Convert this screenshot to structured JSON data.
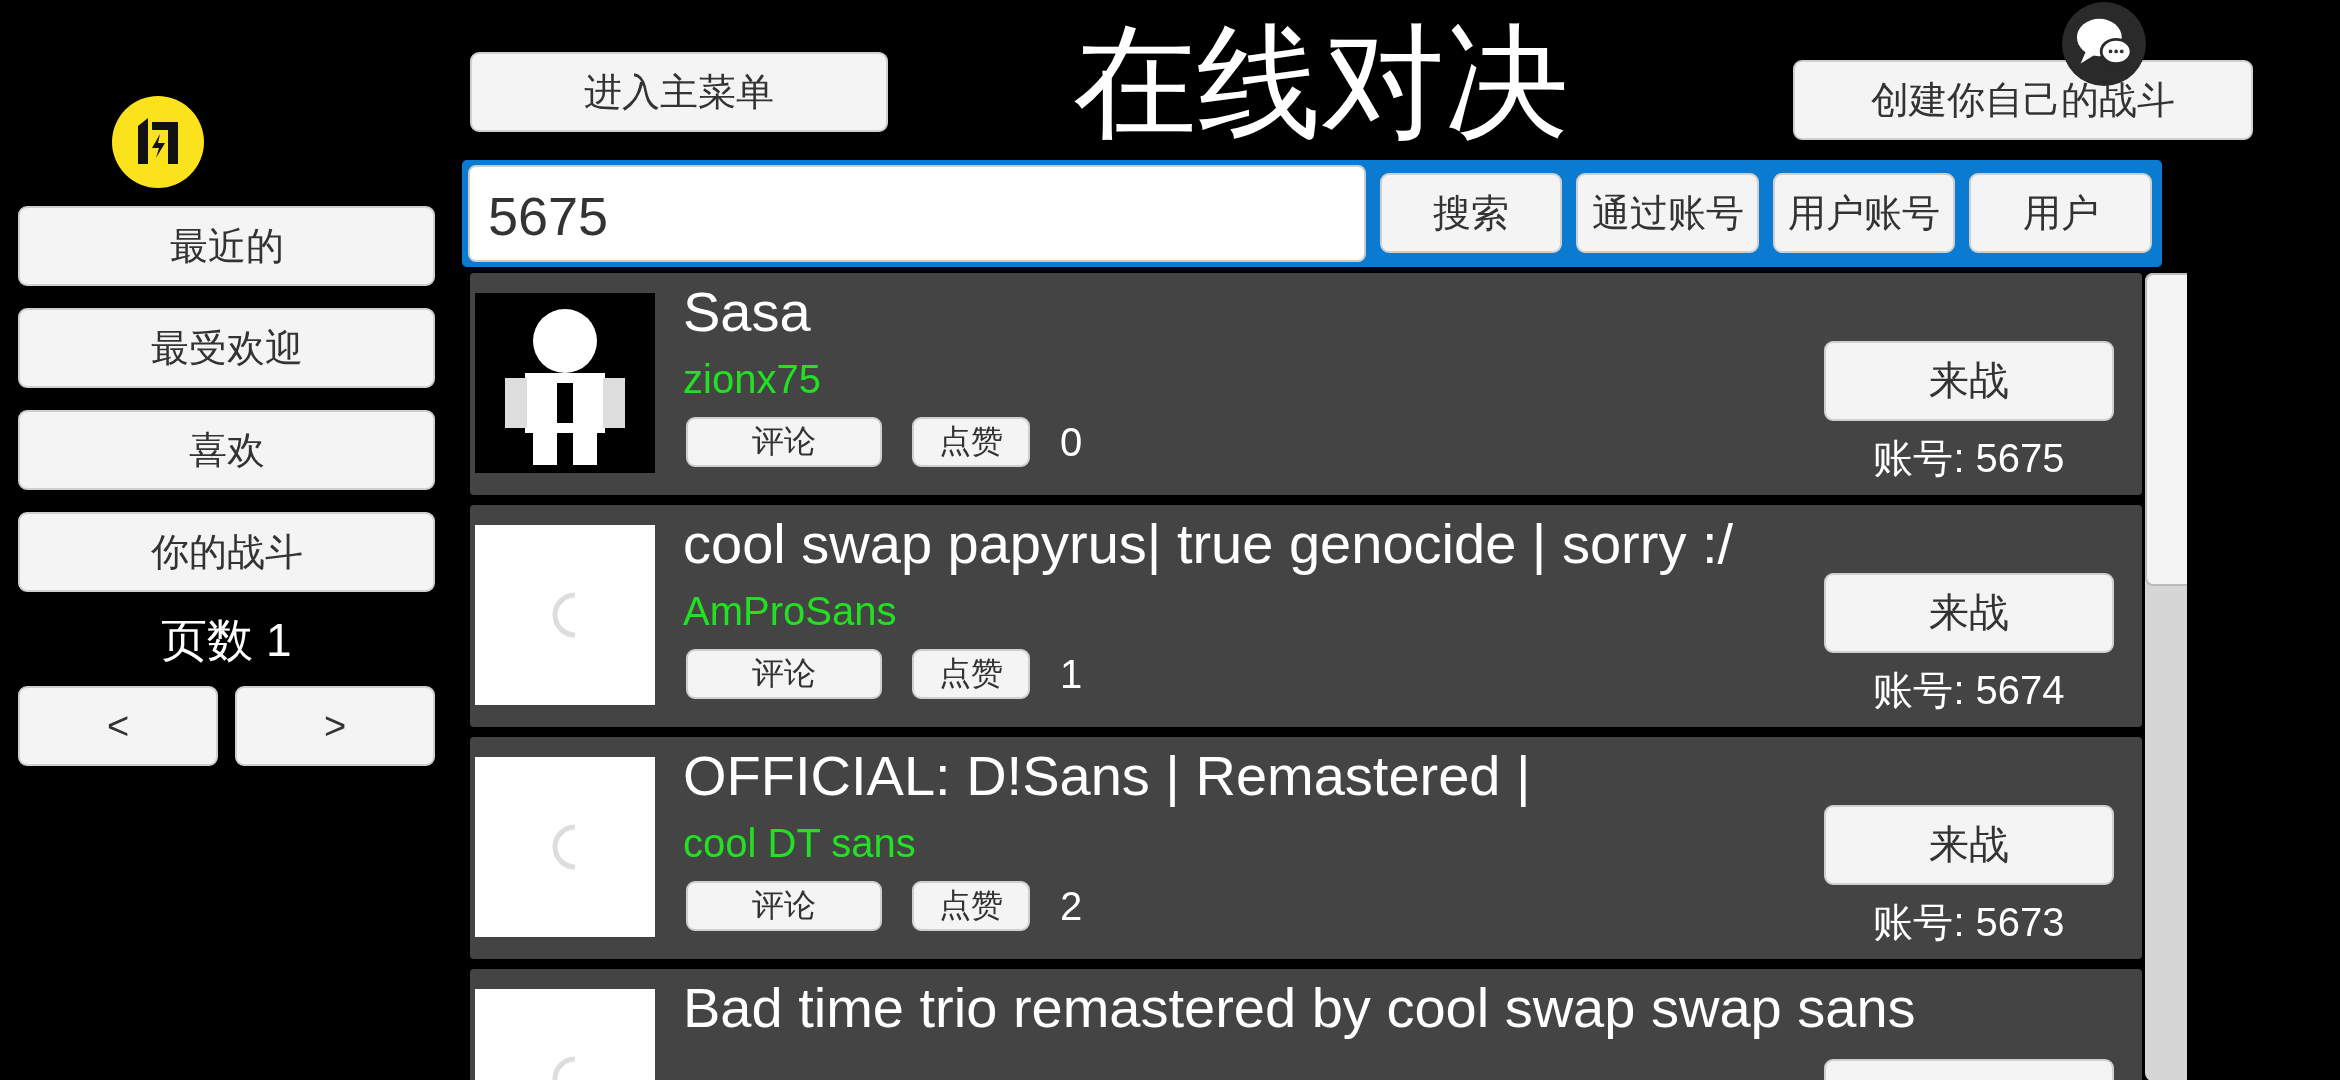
{
  "title": "在线对决",
  "main_menu_button": "进入主菜单",
  "create_button": "创建你自己的战斗",
  "sidebar": {
    "items": [
      {
        "label": "最近的"
      },
      {
        "label": "最受欢迎"
      },
      {
        "label": "喜欢"
      },
      {
        "label": "你的战斗"
      }
    ],
    "page_label": "页数 1",
    "prev": "<",
    "next": ">"
  },
  "search": {
    "value": "5675",
    "buttons": [
      "搜索",
      "通过账号",
      "用户账号",
      "用户"
    ]
  },
  "battles": [
    {
      "title": "Sasa",
      "author": "zionx75",
      "comment": "评论",
      "like": "点赞",
      "likes": "0",
      "fight": "来战",
      "id": "账号: 5675"
    },
    {
      "thumbnail": {
        "kind": "loading"
      },
      "title": "cool swap papyrus| true genocide | sorry :/",
      "author": "AmProSans",
      "comment": "评论",
      "like": "点赞",
      "likes": "1",
      "fight": "来战",
      "id": "账号: 5674"
    },
    {
      "thumbnail": {
        "kind": "loading"
      },
      "title": "OFFICIAL: D!Sans | Remastered |",
      "author": "cool DT sans",
      "comment": "评论",
      "like": "点赞",
      "likes": "2",
      "fight": "来战",
      "id": "账号: 5673"
    },
    {
      "thumbnail": {
        "kind": "loading"
      },
      "title": "Bad time trio remastered by cool swap swap sans"
    }
  ]
}
